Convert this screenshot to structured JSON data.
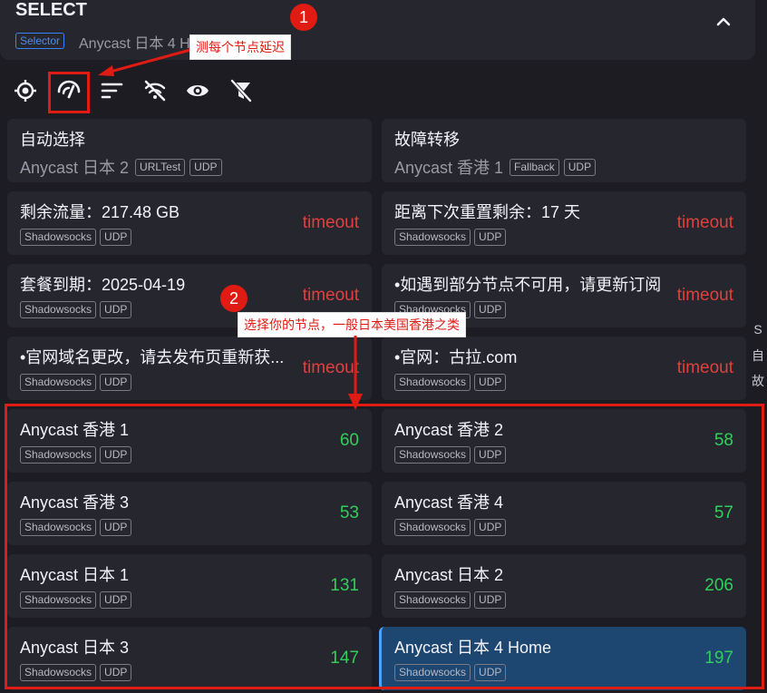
{
  "header": {
    "title": "SELECT",
    "badge": "Selector",
    "current": "Anycast 日本 4 H"
  },
  "toolbar": {
    "icons": [
      "locate-icon",
      "speed-test-icon",
      "sort-icon",
      "hide-icon",
      "eye-icon",
      "filter-off-icon"
    ]
  },
  "annotations": {
    "step1_number": "1",
    "step1_text": "测每个节点延迟",
    "step2_number": "2",
    "step2_text": "选择你的节点，一般日本美国香港之类"
  },
  "edge_text": [
    "S",
    "自",
    "故"
  ],
  "groups": [
    {
      "name": "自动选择",
      "sub": "Anycast 日本 2",
      "tags": [
        "URLTest",
        "UDP"
      ]
    },
    {
      "name": "故障转移",
      "sub": "Anycast 香港 1",
      "tags": [
        "Fallback",
        "UDP"
      ]
    }
  ],
  "proxies": [
    {
      "name": "剩余流量：217.48 GB",
      "tags": [
        "Shadowsocks",
        "UDP"
      ],
      "delay": "timeout",
      "status": "bad"
    },
    {
      "name": "距离下次重置剩余：17 天",
      "tags": [
        "Shadowsocks",
        "UDP"
      ],
      "delay": "timeout",
      "status": "bad"
    },
    {
      "name": "套餐到期：2025-04-19",
      "tags": [
        "Shadowsocks",
        "UDP"
      ],
      "delay": "timeout",
      "status": "bad"
    },
    {
      "name": "•如遇到部分节点不可用，请更新订阅",
      "tags": [
        "Shadowsocks",
        "UDP"
      ],
      "delay": "timeout",
      "status": "bad"
    },
    {
      "name": "•官网域名更改，请去发布页重新获...",
      "tags": [
        "Shadowsocks",
        "UDP"
      ],
      "delay": "timeout",
      "status": "bad"
    },
    {
      "name": "•官网：古拉.com",
      "tags": [
        "Shadowsocks",
        "UDP"
      ],
      "delay": "timeout",
      "status": "bad"
    },
    {
      "name": "Anycast 香港 1",
      "tags": [
        "Shadowsocks",
        "UDP"
      ],
      "delay": "60",
      "status": "good"
    },
    {
      "name": "Anycast 香港 2",
      "tags": [
        "Shadowsocks",
        "UDP"
      ],
      "delay": "58",
      "status": "good"
    },
    {
      "name": "Anycast 香港 3",
      "tags": [
        "Shadowsocks",
        "UDP"
      ],
      "delay": "53",
      "status": "good"
    },
    {
      "name": "Anycast 香港 4",
      "tags": [
        "Shadowsocks",
        "UDP"
      ],
      "delay": "57",
      "status": "good"
    },
    {
      "name": "Anycast 日本 1",
      "tags": [
        "Shadowsocks",
        "UDP"
      ],
      "delay": "131",
      "status": "good"
    },
    {
      "name": "Anycast 日本 2",
      "tags": [
        "Shadowsocks",
        "UDP"
      ],
      "delay": "206",
      "status": "good"
    },
    {
      "name": "Anycast 日本 3",
      "tags": [
        "Shadowsocks",
        "UDP"
      ],
      "delay": "147",
      "status": "good"
    },
    {
      "name": "Anycast 日本 4 Home",
      "tags": [
        "Shadowsocks",
        "UDP"
      ],
      "delay": "197",
      "status": "good",
      "selected": true
    }
  ]
}
